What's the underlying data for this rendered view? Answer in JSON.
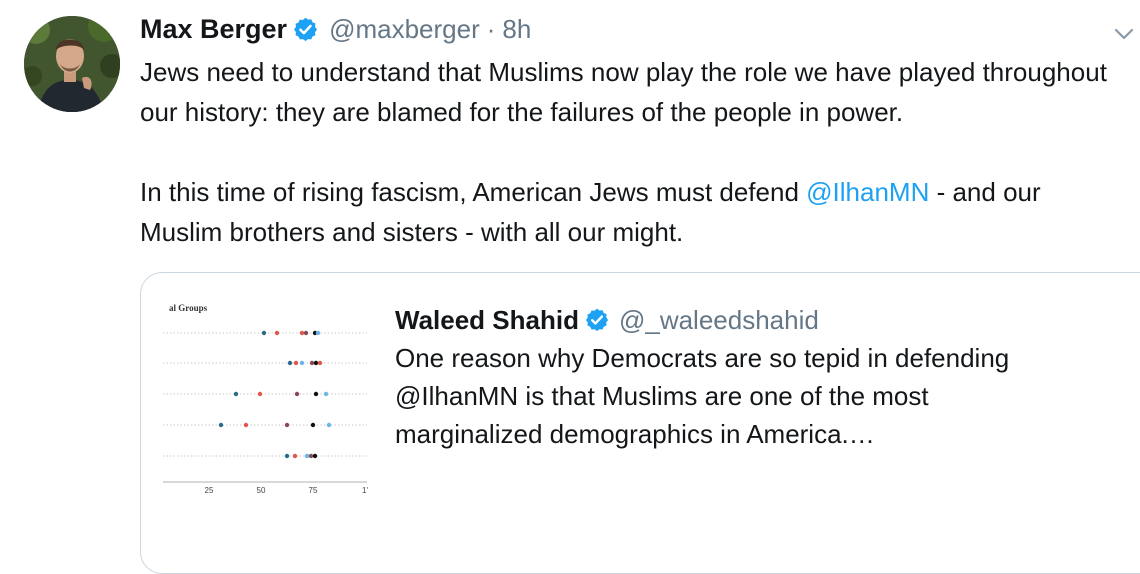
{
  "tweet": {
    "display_name": "Max Berger",
    "handle": "@maxberger",
    "separator": "·",
    "time": "8h",
    "text_p1": "Jews need to understand that Muslims now play the role we have played throughout our history: they are blamed for the failures of the people in power.",
    "text_p2_before": "In this time of rising fascism, American Jews must defend ",
    "text_p2_mention": "@IlhanMN",
    "text_p2_after": " - and our Muslim brothers and sisters - with all our might."
  },
  "quoted": {
    "display_name": "Waleed Shahid",
    "handle": "@_waleedshahid",
    "text": "One reason why Democrats are so tepid in defending @IlhanMN is that Muslims are one of the most marginalized demographics in America.…",
    "thumbnail": {
      "title": "al Groups",
      "tick_labels": [
        "25",
        "50",
        "75",
        "1'"
      ]
    }
  },
  "colors": {
    "text": "#14171a",
    "secondary": "#657786",
    "link": "#1da1f2",
    "verified": "#1da1f2",
    "border": "#ccd6dd"
  },
  "icons": {
    "verified": "verified-badge-icon",
    "menu": "chevron-down-icon"
  }
}
